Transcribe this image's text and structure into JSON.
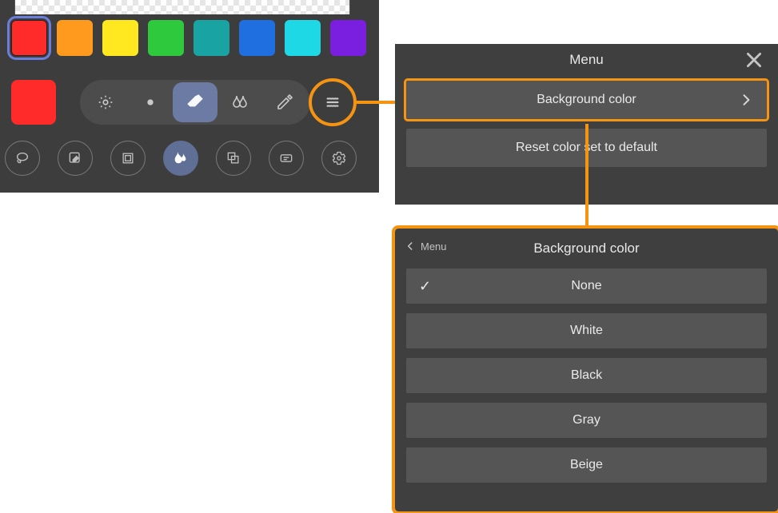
{
  "palette": {
    "swatches": [
      {
        "color": "#ff2a2a",
        "selected": true
      },
      {
        "color": "#ff9a1f",
        "selected": false
      },
      {
        "color": "#ffe81f",
        "selected": false
      },
      {
        "color": "#2fc93d",
        "selected": false
      },
      {
        "color": "#1aa3a3",
        "selected": false
      },
      {
        "color": "#1f6fe0",
        "selected": false
      },
      {
        "color": "#1fd8e6",
        "selected": false
      },
      {
        "color": "#7a1fe0",
        "selected": false
      }
    ],
    "current_color": "#ff2a2a"
  },
  "pill_tools": [
    {
      "name": "brightness",
      "active": false
    },
    {
      "name": "dot",
      "active": false
    },
    {
      "name": "eraser",
      "active": true
    },
    {
      "name": "blur",
      "active": false
    },
    {
      "name": "eyedropper",
      "active": false
    }
  ],
  "bottom_tools": [
    {
      "name": "lasso"
    },
    {
      "name": "edit"
    },
    {
      "name": "frame"
    },
    {
      "name": "smudge-active"
    },
    {
      "name": "layers"
    },
    {
      "name": "text"
    },
    {
      "name": "settings"
    }
  ],
  "menu_panel": {
    "title": "Menu",
    "items": [
      {
        "label": "Background color",
        "has_chevron": true,
        "highlighted": true
      },
      {
        "label": "Reset color set to default",
        "has_chevron": false,
        "highlighted": false
      }
    ]
  },
  "bg_panel": {
    "title": "Background color",
    "back_label": "Menu",
    "options": [
      {
        "label": "None",
        "checked": true
      },
      {
        "label": "White",
        "checked": false
      },
      {
        "label": "Black",
        "checked": false
      },
      {
        "label": "Gray",
        "checked": false
      },
      {
        "label": "Beige",
        "checked": false
      }
    ]
  }
}
